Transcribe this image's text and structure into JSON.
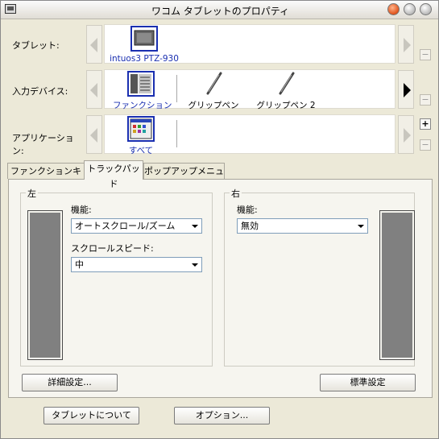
{
  "window": {
    "title": "ワコム タブレットのプロパティ"
  },
  "rows": {
    "tablet": {
      "label": "タブレット:",
      "items": [
        {
          "label": "intuos3 PTZ-930"
        }
      ]
    },
    "input_device": {
      "label": "入力デバイス:",
      "items": [
        {
          "label": "ファンクション"
        },
        {
          "label": "グリップペン"
        },
        {
          "label": "グリップペン 2"
        }
      ]
    },
    "application": {
      "label": "アプリケーション:",
      "items": [
        {
          "label": "すべて"
        }
      ]
    }
  },
  "side_buttons": {
    "minus": "−",
    "plus": "+"
  },
  "tabs": [
    {
      "label": "ファンクションキー"
    },
    {
      "label": "トラックパッド"
    },
    {
      "label": "ポップアップメニュー"
    }
  ],
  "left_group": {
    "title": "左",
    "function_label": "機能:",
    "function_value": "オートスクロール/ズーム",
    "speed_label": "スクロールスピード:",
    "speed_value": "中"
  },
  "right_group": {
    "title": "右",
    "function_label": "機能:",
    "function_value": "無効"
  },
  "buttons": {
    "advanced": "詳細設定...",
    "default": "標準設定",
    "about": "タブレットについて",
    "options": "オプション..."
  }
}
